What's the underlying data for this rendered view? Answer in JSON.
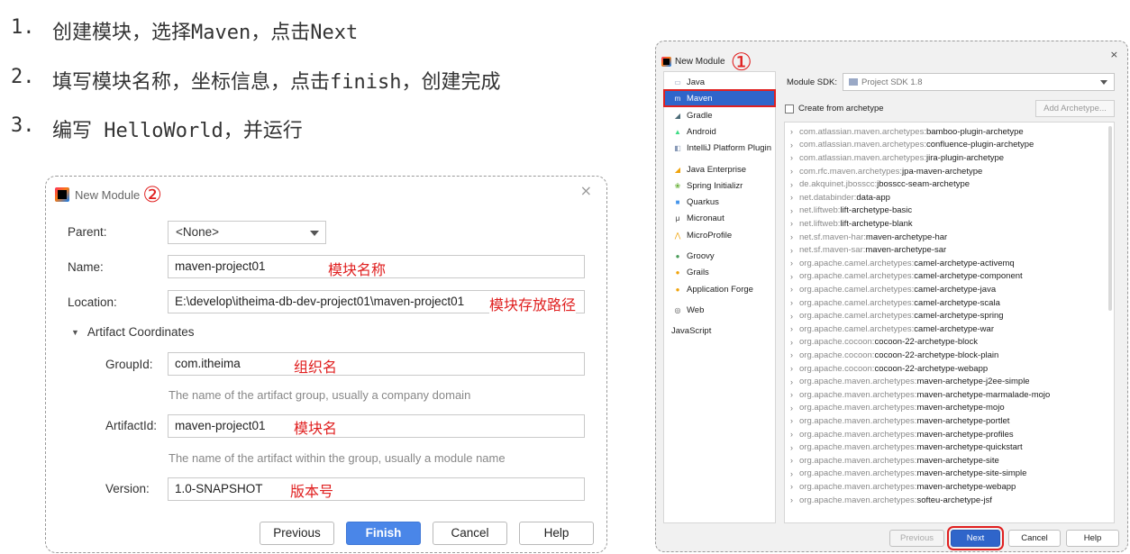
{
  "steps": [
    {
      "num": "1.",
      "text": "创建模块，选择Maven，点击Next"
    },
    {
      "num": "2.",
      "text": "填写模块名称，坐标信息，点击finish，创建完成"
    },
    {
      "num": "3.",
      "text": "编写 HelloWorld，并运行"
    }
  ],
  "dialog2": {
    "title": "New Module",
    "marker": "②",
    "close": "×",
    "parent": {
      "label": "Parent:",
      "value": "<None>"
    },
    "name": {
      "label": "Name:",
      "value": "maven-project01",
      "annotation": "模块名称"
    },
    "location": {
      "label": "Location:",
      "value": "E:\\develop\\itheima-db-dev-project01\\maven-project01",
      "annotation": "模块存放路径"
    },
    "section": {
      "arrow": "▼",
      "label": "Artifact Coordinates"
    },
    "groupId": {
      "label": "GroupId:",
      "value": "com.itheima",
      "annotation": "组织名",
      "hint": "The name of the artifact group, usually a company domain"
    },
    "artifactId": {
      "label": "ArtifactId:",
      "value": "maven-project01",
      "annotation": "模块名",
      "hint": "The name of the artifact within the group, usually a module name"
    },
    "version": {
      "label": "Version:",
      "value": "1.0-SNAPSHOT",
      "annotation": "版本号"
    },
    "buttons": {
      "previous": "Previous",
      "finish": "Finish",
      "cancel": "Cancel",
      "help": "Help"
    }
  },
  "dialog1": {
    "title": "New Module",
    "marker": "①",
    "close": "×",
    "generators": [
      {
        "label": "Java",
        "icon": "folder-icon",
        "glyph": "▭",
        "color": "#8a9bb8",
        "selected": false
      },
      {
        "label": "Maven",
        "icon": "maven-icon",
        "glyph": "m",
        "color": "#c33b7a",
        "selected": true
      },
      {
        "label": "Gradle",
        "icon": "gradle-icon",
        "glyph": "◢",
        "color": "#4b6b77",
        "selected": false
      },
      {
        "label": "Android",
        "icon": "android-icon",
        "glyph": "▲",
        "color": "#3ddc84",
        "selected": false
      },
      {
        "label": "IntelliJ Platform Plugin",
        "icon": "plugin-icon",
        "glyph": "◧",
        "color": "#8a9bb8",
        "selected": false
      },
      {
        "label": "Java Enterprise",
        "icon": "java-enterprise-icon",
        "glyph": "◢",
        "color": "#f0a30a",
        "selected": false
      },
      {
        "label": "Spring Initializr",
        "icon": "spring-icon",
        "glyph": "❀",
        "color": "#6db33f",
        "selected": false
      },
      {
        "label": "Quarkus",
        "icon": "quarkus-icon",
        "glyph": "■",
        "color": "#4695eb",
        "selected": false
      },
      {
        "label": "Micronaut",
        "icon": "micronaut-icon",
        "glyph": "μ",
        "color": "#333333",
        "selected": false
      },
      {
        "label": "MicroProfile",
        "icon": "microprofile-icon",
        "glyph": "⋀",
        "color": "#f0a30a",
        "selected": false
      },
      {
        "label": "Groovy",
        "icon": "groovy-icon",
        "glyph": "●",
        "color": "#4a9c59",
        "selected": false
      },
      {
        "label": "Grails",
        "icon": "grails-icon",
        "glyph": "●",
        "color": "#f0a30a",
        "selected": false
      },
      {
        "label": "Application Forge",
        "icon": "application-forge-icon",
        "glyph": "●",
        "color": "#f0a30a",
        "selected": false
      },
      {
        "label": "Web",
        "icon": "web-icon",
        "glyph": "◎",
        "color": "#555555",
        "selected": false
      },
      {
        "label": "JavaScript",
        "icon": "",
        "glyph": "",
        "color": "#333333",
        "selected": false
      }
    ],
    "sdk": {
      "label": "Module SDK:",
      "value": "Project SDK 1.8"
    },
    "create_from_archetype": "Create from archetype",
    "add_archetype": "Add Archetype...",
    "archetypes": [
      {
        "group": "com.atlassian.maven.archetypes:",
        "artifact": "bamboo-plugin-archetype"
      },
      {
        "group": "com.atlassian.maven.archetypes:",
        "artifact": "confluence-plugin-archetype"
      },
      {
        "group": "com.atlassian.maven.archetypes:",
        "artifact": "jira-plugin-archetype"
      },
      {
        "group": "com.rfc.maven.archetypes:",
        "artifact": "jpa-maven-archetype"
      },
      {
        "group": "de.akquinet.jbosscc:",
        "artifact": "jbosscc-seam-archetype"
      },
      {
        "group": "net.databinder:",
        "artifact": "data-app"
      },
      {
        "group": "net.liftweb:",
        "artifact": "lift-archetype-basic"
      },
      {
        "group": "net.liftweb:",
        "artifact": "lift-archetype-blank"
      },
      {
        "group": "net.sf.maven-har:",
        "artifact": "maven-archetype-har"
      },
      {
        "group": "net.sf.maven-sar:",
        "artifact": "maven-archetype-sar"
      },
      {
        "group": "org.apache.camel.archetypes:",
        "artifact": "camel-archetype-activemq"
      },
      {
        "group": "org.apache.camel.archetypes:",
        "artifact": "camel-archetype-component"
      },
      {
        "group": "org.apache.camel.archetypes:",
        "artifact": "camel-archetype-java"
      },
      {
        "group": "org.apache.camel.archetypes:",
        "artifact": "camel-archetype-scala"
      },
      {
        "group": "org.apache.camel.archetypes:",
        "artifact": "camel-archetype-spring"
      },
      {
        "group": "org.apache.camel.archetypes:",
        "artifact": "camel-archetype-war"
      },
      {
        "group": "org.apache.cocoon:",
        "artifact": "cocoon-22-archetype-block"
      },
      {
        "group": "org.apache.cocoon:",
        "artifact": "cocoon-22-archetype-block-plain"
      },
      {
        "group": "org.apache.cocoon:",
        "artifact": "cocoon-22-archetype-webapp"
      },
      {
        "group": "org.apache.maven.archetypes:",
        "artifact": "maven-archetype-j2ee-simple"
      },
      {
        "group": "org.apache.maven.archetypes:",
        "artifact": "maven-archetype-marmalade-mojo"
      },
      {
        "group": "org.apache.maven.archetypes:",
        "artifact": "maven-archetype-mojo"
      },
      {
        "group": "org.apache.maven.archetypes:",
        "artifact": "maven-archetype-portlet"
      },
      {
        "group": "org.apache.maven.archetypes:",
        "artifact": "maven-archetype-profiles"
      },
      {
        "group": "org.apache.maven.archetypes:",
        "artifact": "maven-archetype-quickstart"
      },
      {
        "group": "org.apache.maven.archetypes:",
        "artifact": "maven-archetype-site"
      },
      {
        "group": "org.apache.maven.archetypes:",
        "artifact": "maven-archetype-site-simple"
      },
      {
        "group": "org.apache.maven.archetypes:",
        "artifact": "maven-archetype-webapp"
      },
      {
        "group": "org.apache.maven.archetypes:",
        "artifact": "softeu-archetype-jsf"
      }
    ],
    "buttons": {
      "previous": "Previous",
      "next": "Next",
      "cancel": "Cancel",
      "help": "Help"
    }
  }
}
